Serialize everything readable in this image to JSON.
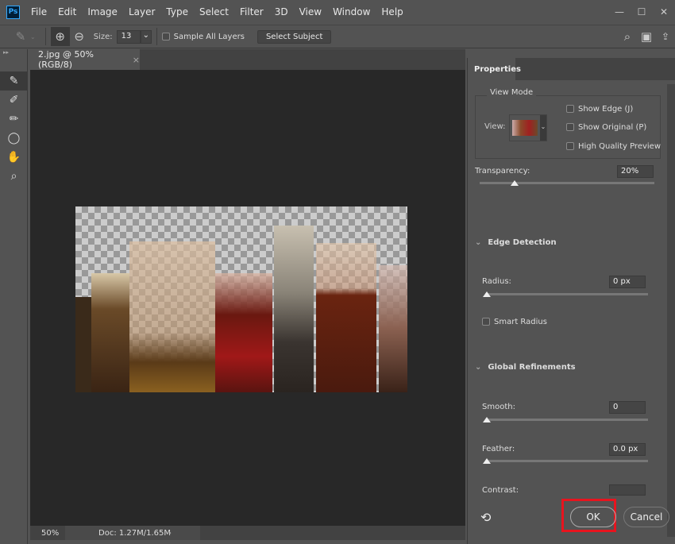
{
  "app": {
    "logo": "Ps",
    "menus": [
      "File",
      "Edit",
      "Image",
      "Layer",
      "Type",
      "Select",
      "Filter",
      "3D",
      "View",
      "Window",
      "Help"
    ]
  },
  "options": {
    "size_label": "Size:",
    "size_value": "13",
    "sample_all_layers": "Sample All Layers",
    "select_subject": "Select Subject"
  },
  "document_tab": {
    "title": "2.jpg @ 50% (RGB/8)",
    "close": "×"
  },
  "status": {
    "zoom": "50%",
    "doc": "Doc: 1.27M/1.65M",
    "arrow": "›"
  },
  "properties": {
    "tab": "Properties",
    "view_mode": {
      "title": "View Mode",
      "view_label": "View:",
      "show_edge": "Show Edge (J)",
      "show_original": "Show Original (P)",
      "high_quality": "High Quality Preview"
    },
    "transparency": {
      "label": "Transparency:",
      "value": "20%",
      "percent": 20
    },
    "edge_detection": {
      "title": "Edge Detection",
      "radius_label": "Radius:",
      "radius_value": "0 px",
      "smart_radius": "Smart Radius"
    },
    "global_refinements": {
      "title": "Global Refinements",
      "smooth_label": "Smooth:",
      "smooth_value": "0",
      "feather_label": "Feather:",
      "feather_value": "0.0 px",
      "contrast_label": "Contrast:"
    },
    "ok": "OK",
    "cancel": "Cancel"
  },
  "colors": {
    "highlight": "#e8141e",
    "ps_blue": "#31a8ff"
  }
}
